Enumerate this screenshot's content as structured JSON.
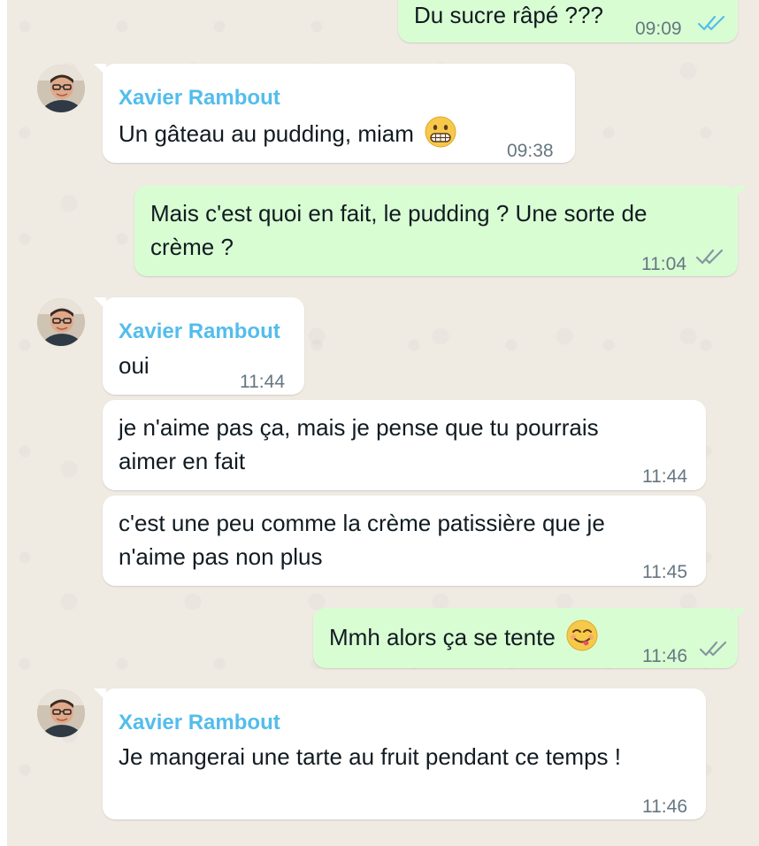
{
  "contact": {
    "name": "Xavier Rambout"
  },
  "colors": {
    "wallpaper": "#efeae2",
    "incoming_bubble": "#ffffff",
    "outgoing_bubble": "#d9fdd3",
    "sender_name": "#53bdeb",
    "timestamp": "#667781",
    "read_ticks": "#53bdeb",
    "delivered_ticks": "#8696a0"
  },
  "messages": [
    {
      "direction": "out",
      "text": "Du sucre râpé ???",
      "time": "09:09",
      "status": "read",
      "status_icon": "double-check-blue-icon"
    },
    {
      "direction": "in",
      "sender": "Xavier Rambout",
      "text": "Un gâteau au pudding, miam",
      "emoji": "grimacing-face-icon",
      "time": "09:38"
    },
    {
      "direction": "out",
      "lines": [
        "Mais c'est quoi en fait, le pudding ? Une sorte de",
        "crème ?"
      ],
      "time": "11:04",
      "status": "delivered",
      "status_icon": "double-check-grey-icon"
    },
    {
      "direction": "in",
      "sender": "Xavier Rambout",
      "text": "oui",
      "time": "11:44"
    },
    {
      "direction": "in",
      "lines": [
        "je n'aime pas ça, mais je pense que tu pourrais",
        "aimer en fait"
      ],
      "time": "11:44"
    },
    {
      "direction": "in",
      "lines": [
        "c'est une peu comme la crème patissière que je",
        "n'aime pas non plus"
      ],
      "time": "11:45"
    },
    {
      "direction": "out",
      "text": "Mmh alors ça se tente",
      "emoji": "face-savoring-food-icon",
      "time": "11:46",
      "status": "delivered",
      "status_icon": "double-check-grey-icon"
    },
    {
      "direction": "in",
      "sender": "Xavier Rambout",
      "text": "Je mangerai une tarte au fruit pendant ce temps !",
      "time": "11:46"
    }
  ]
}
